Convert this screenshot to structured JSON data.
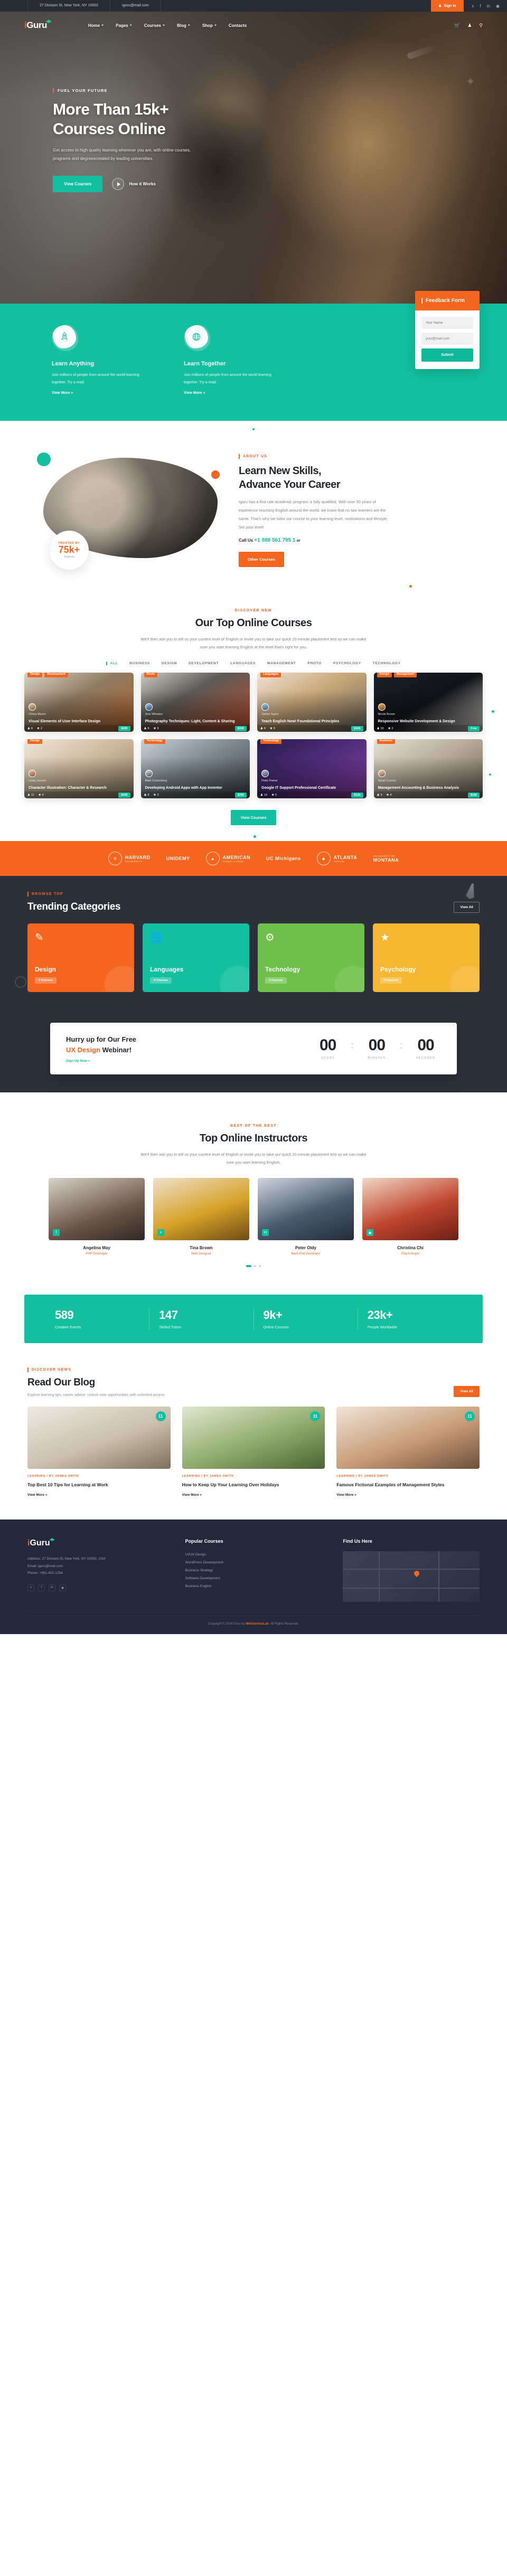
{
  "topbar": {
    "address": "27 Division St, New York, NY 10002",
    "email": "iguru@mail.com",
    "signin": "Sign In",
    "social": [
      "twitter-icon",
      "facebook-icon",
      "linkedin-icon",
      "instagram-icon"
    ]
  },
  "brand": {
    "name": "Guru",
    "prefix": "i"
  },
  "nav": {
    "items": [
      {
        "label": "Home",
        "caret": "+"
      },
      {
        "label": "Pages",
        "caret": "+"
      },
      {
        "label": "Courses",
        "caret": "+"
      },
      {
        "label": "Blog",
        "caret": "+"
      },
      {
        "label": "Shop",
        "caret": "+"
      },
      {
        "label": "Contacts",
        "caret": ""
      }
    ],
    "icons": [
      "cart-icon",
      "user-icon",
      "search-icon"
    ]
  },
  "hero": {
    "eyebrow": "FUEL YOUR FUTURE",
    "title_line1": "More Than 15k+",
    "title_line2": "Courses Online",
    "sub_line1": "Get access to high quality learning wherever you are, with online",
    "sub_line2": "courses, programs and degreescreated by leading universities.",
    "cta": "View Courses",
    "play_label": "How it Works"
  },
  "features": {
    "items": [
      {
        "icon": "rocket-icon",
        "title": "Learn Anything",
        "text_line1": "Join millions of people from around the",
        "text_line2": "world learning together. Try a read.",
        "more": "View More »"
      },
      {
        "icon": "globe-icon",
        "title": "Learn Together",
        "text_line1": "Join millions of people from around the",
        "text_line2": "world learning together. Try a read.",
        "more": "View More »"
      }
    ]
  },
  "feedback": {
    "title": "Feedback Form",
    "name_placeholder": "Your Name",
    "email_placeholder": "your@mail.com",
    "submit": "Submit"
  },
  "about": {
    "eyebrow": "ABOUT US",
    "title_line1": "Learn New Skills,",
    "title_line2": "Advance Your Career",
    "paragraph": "Iguru has a first rate academic program, a fully qualified. With over 50 years of experience teaching English around the world, we know that no two learners are the same. That's why we tailor our course to your learning level, motivations and lifestyle. Set your level!",
    "call_label": "Call Us",
    "phone": "+1 888 561 795 1",
    "or": "or",
    "button": "Other Courses",
    "badge_label": "TRUSTED BY",
    "badge_value": "75k+",
    "badge_sub": "Students"
  },
  "courses": {
    "eyebrow": "DISCOVER NEW",
    "title": "Our Top Online Courses",
    "subtitle": "We'll then ask you to tell us your current level of English or invite you to take our quick 20 minute placement test so we can make sure you start learning English at the level that's right for you.",
    "filters": [
      "ALL",
      "BUSINESS",
      "DESIGN",
      "DEVELOPMENT",
      "LANGUAGES",
      "MANAGEMENT",
      "PHOTO",
      "PSYCHOLOGY",
      "TECHNOLOGY"
    ],
    "active_filter": "ALL",
    "button": "View Courses",
    "items": [
      {
        "tags": [
          "Design",
          "Development"
        ],
        "author": "Chriss Moore",
        "title": "Visual Elements of User Interface Design",
        "students": "6",
        "rating": "2",
        "price": "$200"
      },
      {
        "tags": [
          "Photo"
        ],
        "author": "Joss Whedon",
        "title": "Photography Techniques: Light, Content & Sharing",
        "students": "6",
        "rating": "0",
        "price": "$300"
      },
      {
        "tags": [
          "Languages"
        ],
        "author": "James Taylor",
        "title": "Teach English Now! Foundational Principles",
        "students": "6",
        "rating": "0",
        "price": "$100"
      },
      {
        "tags": [
          "Design",
          "Management"
        ],
        "author": "Nicole Brown",
        "title": "Responsive Website Development & Design",
        "students": "19",
        "rating": "2",
        "price": "Free"
      },
      {
        "tags": [
          "Design"
        ],
        "author": "Linda Jonson",
        "title": "Character Illustration: Character & Research",
        "students": "11",
        "rating": "4",
        "price": "$150"
      },
      {
        "tags": [
          "Technology"
        ],
        "author": "Mark Zuckerberg",
        "title": "Developing Android Apps with App Inventor",
        "students": "8",
        "rating": "3",
        "price": "$250"
      },
      {
        "tags": [
          "Technology"
        ],
        "author": "Peter Parker",
        "title": "Google IT Support Professional Certificate",
        "students": "14",
        "rating": "5",
        "price": "$120"
      },
      {
        "tags": [
          "Business"
        ],
        "author": "Sarah Connor",
        "title": "Management Accounting & Business Analysis",
        "students": "9",
        "rating": "4",
        "price": "$180"
      }
    ]
  },
  "brands": {
    "items": [
      {
        "icon": "seal-icon",
        "name": "HARVARD",
        "sub": "UNIVERSITY"
      },
      {
        "icon": "",
        "name": "UNIDEMY",
        "sub": ""
      },
      {
        "icon": "seal-icon",
        "name": "AMERICAN",
        "sub": "Oregon College"
      },
      {
        "icon": "",
        "name": "UC Michigans",
        "sub": ""
      },
      {
        "icon": "seal-icon",
        "name": "ATLANTA",
        "sub": "Institute"
      },
      {
        "icon": "",
        "name": "MONTANA",
        "sub": "UNIVERSITY OF"
      }
    ]
  },
  "trending": {
    "eyebrow": "BROWSE TOP",
    "title": "Trending Categories",
    "viewall": "View All",
    "categories": [
      {
        "icon": "pencil-icon",
        "name": "Design",
        "count": "3 Courses",
        "color": "#f4661e"
      },
      {
        "icon": "globe-icon",
        "name": "Languages",
        "count": "3 Courses",
        "color": "#12c0a0"
      },
      {
        "icon": "gear-icon",
        "name": "Technology",
        "count": "3 Courses",
        "color": "#6fc04a"
      },
      {
        "icon": "brain-icon",
        "name": "Psychology",
        "count": "2 Courses",
        "color": "#f5b731"
      }
    ]
  },
  "countdown": {
    "line1": "Hurry up for Our Free",
    "line2_a": "UX Design",
    "line2_b": "Webinar!",
    "sign": "Sign Up Now »",
    "units": [
      {
        "num": "00",
        "label": "HOURS"
      },
      {
        "num": "00",
        "label": "MINUTES"
      },
      {
        "num": "00",
        "label": "SECONDS"
      }
    ],
    "sep": ":"
  },
  "instructors": {
    "eyebrow": "BEST OF THE BEST",
    "title": "Top Online Instructors",
    "subtitle": "We'll then ask you to tell us your current level of English or invite you to take our quick 20 minute placement test so we can make sure you start learning English.",
    "items": [
      {
        "name": "Angelina May",
        "role": "PHP Developer",
        "icon": "facebook-icon"
      },
      {
        "name": "Tina Brown",
        "role": "Web Designer",
        "icon": "twitter-icon"
      },
      {
        "name": "Peter Oldy",
        "role": "Back-End Developer",
        "icon": "linkedin-icon"
      },
      {
        "name": "Christina Chi",
        "role": "Psychologist",
        "icon": "instagram-icon"
      }
    ]
  },
  "stats": {
    "items": [
      {
        "num": "589",
        "label": "Creative Events"
      },
      {
        "num": "147",
        "label": "Skilled Tutors"
      },
      {
        "num": "9k+",
        "label": "Online Courses"
      },
      {
        "num": "23k+",
        "label": "People Worldwide"
      }
    ]
  },
  "blog": {
    "eyebrow": "DISCOVER NEWS",
    "title": "Read Our Blog",
    "subtitle": "Explore learning tips, career advice. Unlock new opportunities with unlimited access.",
    "viewall": "View All",
    "posts": [
      {
        "badge": "11",
        "cats": "LEARNING / BY JAMES SMITH",
        "title": "Top Best 10 Tips for Learning at Work",
        "more": "View More »"
      },
      {
        "badge": "11",
        "cats": "LEARNING / BY JAMES SMITH",
        "title": "How to Keep Up Your Learning Over Holidays",
        "more": "View More »"
      },
      {
        "badge": "11",
        "cats": "LEARNING / BY JAMES SMITH",
        "title": "Famous Fictional Examples of Management Styles",
        "more": "View More »"
      }
    ]
  },
  "footer": {
    "about": "Address: 27 Division St, New York, NY 10002, USA\nEmail: iguru@mail.com\nPhone: +951-452-1254",
    "address_line": "Address: 27 Division St, New York, NY 10002, USA",
    "email_line": "Email: iguru@mail.com",
    "phone_line": "Phone: +951-452-1254",
    "popular_title": "Popular Courses",
    "popular": [
      "UI/UX Design",
      "WordPress Development",
      "Business Strategy",
      "Software Development",
      "Business English"
    ],
    "find_title": "Find Us Here",
    "social": [
      "twitter-icon",
      "facebook-icon",
      "linkedin-icon",
      "instagram-icon"
    ],
    "copyright_a": "Copyright © 2024 Guru by ",
    "copyright_b": "WebGeniusLab",
    "copyright_c": ". All Rights Reserved."
  }
}
